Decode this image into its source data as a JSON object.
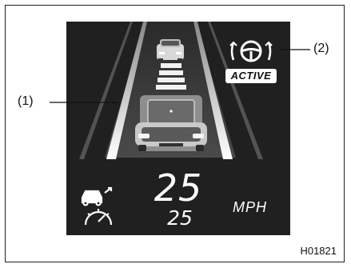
{
  "callouts": {
    "left": "(1)",
    "right": "(2)"
  },
  "display": {
    "status_badge": "ACTIVE",
    "current_speed": "25",
    "set_speed": "25",
    "speed_unit": "MPH"
  },
  "figure_id": "H01821",
  "icons": {
    "steering": "steering-wheel-icon",
    "cruise": "adaptive-cruise-gauge-icon",
    "lead_car": "lead-vehicle-icon",
    "own_car": "own-vehicle-icon"
  },
  "colors": {
    "display_bg": "#202020",
    "road_bg": "#3a3a3a",
    "lane_line": "#f2f2f2"
  }
}
